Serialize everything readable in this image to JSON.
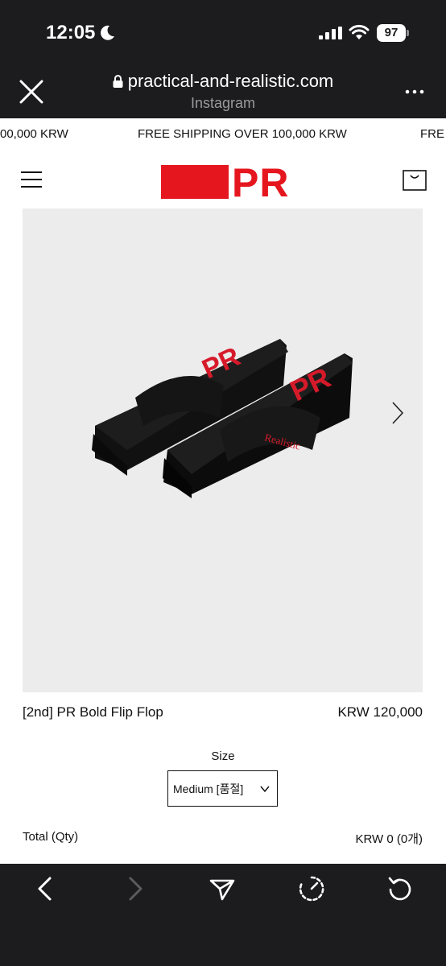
{
  "status_bar": {
    "time": "12:05",
    "battery": "97",
    "icons": [
      "moon-icon",
      "signal-icon",
      "wifi-icon",
      "battery-icon"
    ]
  },
  "browser": {
    "url": "practical-and-realistic.com",
    "source": "Instagram",
    "icons": [
      "close-icon",
      "lock-icon",
      "more-icon"
    ]
  },
  "marquee": {
    "items": [
      "00,000 KRW",
      "FREE SHIPPING OVER 100,000 KRW",
      "FRE"
    ]
  },
  "header": {
    "logo_text": "PR",
    "brand_color": "#e5161e",
    "icons": [
      "menu-icon",
      "cart-icon"
    ]
  },
  "product": {
    "name": "[2nd] PR Bold Flip Flop",
    "price": "KRW 120,000",
    "image_text": [
      "PR",
      "PR",
      "Realistic"
    ],
    "image_background": "#ececec"
  },
  "options": {
    "size_label": "Size",
    "size_selected": "Medium [품절]"
  },
  "total": {
    "label": "Total (Qty)",
    "value": "KRW 0 (0개)"
  },
  "toolbar": {
    "icons": [
      "back-icon",
      "forward-icon",
      "share-icon",
      "timer-icon",
      "reload-icon"
    ]
  }
}
